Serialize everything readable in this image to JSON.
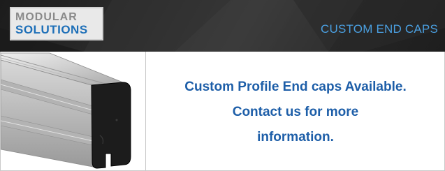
{
  "header": {
    "logo": {
      "line1": "MODULAR",
      "line2": "SOLUTIONS"
    },
    "title": "CUSTOM END CAPS"
  },
  "image_panel": {
    "icon": "aluminum-profile-with-end-cap"
  },
  "message": {
    "line1": "Custom Profile End caps Available.",
    "line2": "Contact us for more",
    "line3": "information."
  },
  "colors": {
    "header_bg": "#2b2b2b",
    "title_color": "#4a9fe0",
    "logo_blue": "#1d6fb8",
    "logo_grey": "#8a8a8a",
    "message_color": "#1d5ea8",
    "border": "#c9c9c9"
  }
}
